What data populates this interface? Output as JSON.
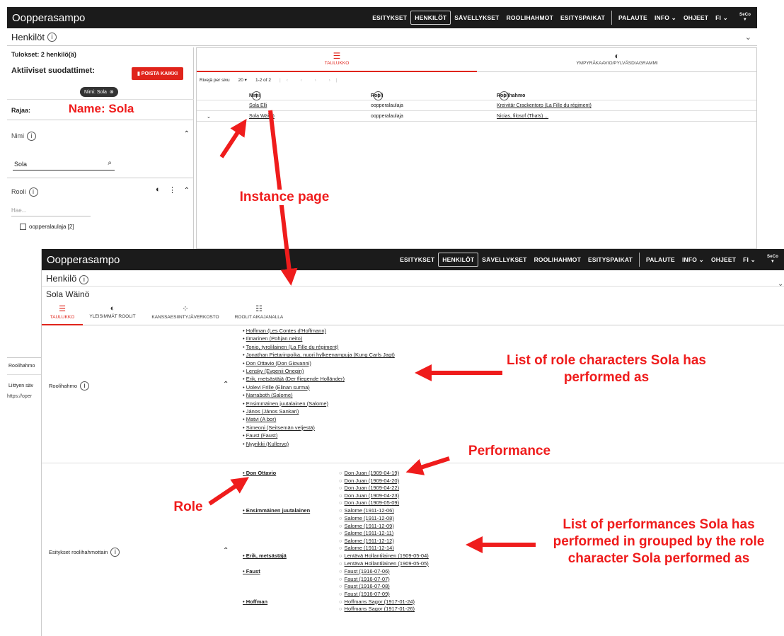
{
  "upper": {
    "brand": "Oopperasampo",
    "nav": [
      "ESITYKSET",
      "HENKILÖT",
      "SÄVELLYKSET",
      "ROOLIHAHMOT",
      "ESITYSPAIKAT"
    ],
    "nav_right": [
      "PALAUTE",
      "INFO ⌄",
      "OHJEET",
      "FI ⌄"
    ],
    "logo": "SeCo",
    "page_title": "Henkilöt",
    "results": "Tulokset: 2 henkilö(ä)",
    "active_filters": "Aktiiviset suodattimet:",
    "remove_all": "POISTA KAIKKI",
    "chip": "Nimi: Sola",
    "limit": "Rajaa:",
    "name_facet": "Nimi",
    "name_value": "Sola",
    "role_facet": "Rooli",
    "role_placeholder": "Hae...",
    "role_option": "oopperalaulaja [2]",
    "bottom_rows": [
      "Roolihahmo",
      "Liittyen säv"
    ],
    "status_url": "https://oper",
    "tabs": [
      "TAULUKKO",
      "YMPYRÄKAAVIO/PYLVÄSDIAGRAMMI"
    ],
    "rows_per_page": "Rivejä per sivu",
    "rows_value": "20",
    "range": "1-2 of 2",
    "columns": [
      "Nimi",
      "Rooli",
      "Roolihahmo"
    ],
    "rows": [
      {
        "name": "Sola Elli",
        "role": "oopperalaulaja",
        "character": "Kreivitär Crackentorp (La Fille du régiment)"
      },
      {
        "name": "Sola Wäinö",
        "role": "oopperalaulaja",
        "character": "Nicias, filosof (Thaïs) ..."
      }
    ]
  },
  "lower": {
    "brand": "Oopperasampo",
    "nav": [
      "ESITYKSET",
      "HENKILÖT",
      "SÄVELLYKSET",
      "ROOLIHAHMOT",
      "ESITYSPAIKAT"
    ],
    "nav_right": [
      "PALAUTE",
      "INFO ⌄",
      "OHJEET",
      "FI ⌄"
    ],
    "logo": "SeCo",
    "type_title": "Henkilö",
    "person_name": "Sola Wäinö",
    "tabs": [
      "TAULUKKO",
      "YLEISIMMÄT ROOLIT",
      "KANSSAESIINTYJÄVERKOSTO",
      "ROOLIT AIKAJANALLA"
    ],
    "characters_label": "Roolihahmo",
    "characters": [
      "Hoffman (Les Contes d'Hoffmann)",
      "Ilmarinen (Pohjan neito)",
      "Tonio, tyrolilainen (La Fille du régiment)",
      "Jonathan Pietarinpoika, nuori hylkeenampuja (Kung Carls Jagt)",
      "Don Ottavio (Don Giovanni)",
      "Lensky (Evgenii Onegin)",
      "Erik, metsästäjä (Der fliegende Holländer)",
      "Uolevi Frille (Elinan surma)",
      "Narraboth (Salome)",
      "Ensimmäinen juutalainen (Salome)",
      "János (János Sankari)",
      "Matvi (A bor)",
      "Simeoni (Seitsemän veljestä)",
      "Faust (Faust)",
      "Nyyrikki (Kullervo)"
    ],
    "performances_label": "Esitykset roolihahmottain",
    "groups": [
      {
        "role": "Don Ottavio",
        "items": [
          "Don Juan (1909-04-19)",
          "Don Juan (1909-04-20)",
          "Don Juan (1909-04-22)",
          "Don Juan (1909-04-23)",
          "Don Juan (1909-05-09)"
        ]
      },
      {
        "role": "Ensimmäinen juutalainen",
        "items": [
          "Salome (1911-12-06)",
          "Salome (1911-12-08)",
          "Salome (1911-12-09)",
          "Salome (1911-12-11)",
          "Salome (1911-12-12)",
          "Salome (1911-12-14)"
        ]
      },
      {
        "role": "Erik, metsästäjä",
        "items": [
          "Lentävä Hollantilainen (1909-05-04)",
          "Lentävä Hollantilainen (1909-05-05)"
        ]
      },
      {
        "role": "Faust",
        "items": [
          "Faust (1916-07-06)",
          "Faust (1916-07-07)",
          "Faust (1916-07-08)",
          "Faust (1916-07-09)"
        ]
      },
      {
        "role": "Hoffman",
        "items": [
          "Hoffmans Sagor (1917-01-24)",
          "Hoffmans Sagor (1917-01-26)"
        ]
      }
    ]
  },
  "annotations": {
    "name": "Name: Sola",
    "instance": "Instance page",
    "role_chars": "List of role characters Sola has performed as",
    "performance": "Performance",
    "role": "Role",
    "perf_list": "List of performances Sola has performed in grouped by the role character Sola performed as"
  },
  "colors": {
    "appbar": "#1b1b1b",
    "accent_red": "#e0241b",
    "annotation_red": "#ef1c1c"
  }
}
